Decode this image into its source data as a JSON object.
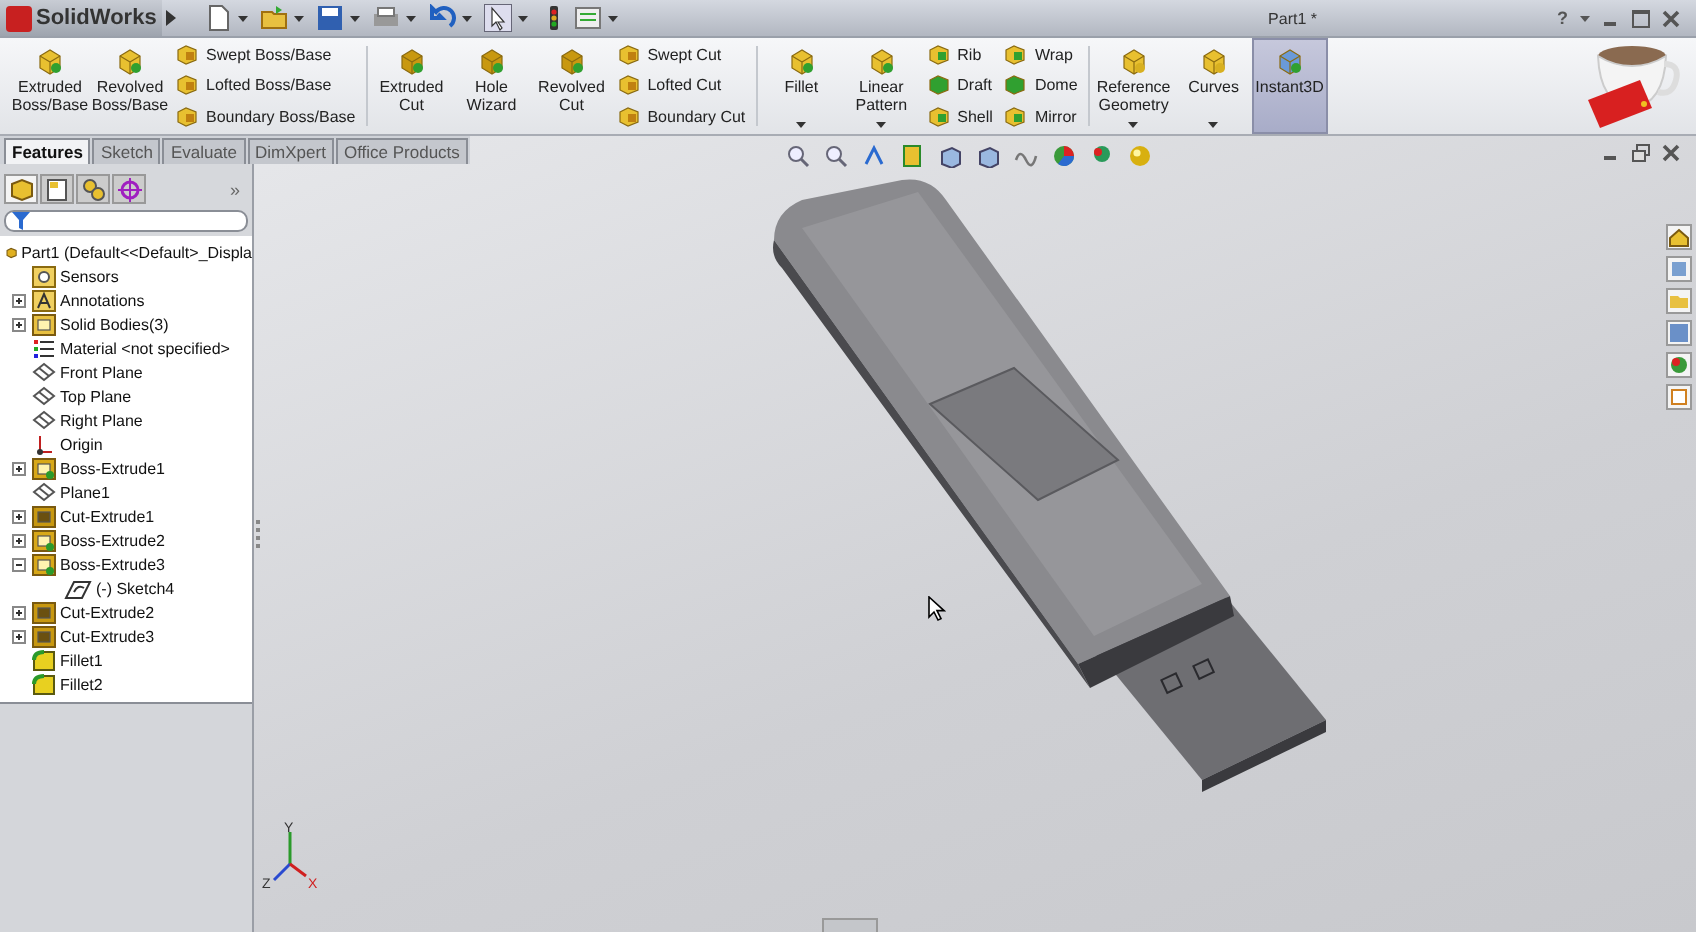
{
  "app": {
    "logo": "SolidWorks",
    "title": "Part1 *",
    "help": "?"
  },
  "ribbon": {
    "groups": [
      {
        "items": [
          {
            "kind": "large",
            "label": "Extruded Boss/Base",
            "dropdown": false,
            "on": false
          },
          {
            "kind": "large",
            "label": "Revolved Boss/Base",
            "dropdown": false,
            "on": false
          },
          {
            "kind": "stack",
            "entries": [
              "Swept Boss/Base",
              "Lofted Boss/Base",
              "Boundary Boss/Base"
            ]
          }
        ]
      },
      {
        "items": [
          {
            "kind": "large",
            "label": "Extruded Cut",
            "dropdown": false,
            "on": false
          },
          {
            "kind": "large",
            "label": "Hole Wizard",
            "dropdown": false,
            "on": false
          },
          {
            "kind": "large",
            "label": "Revolved Cut",
            "dropdown": false,
            "on": false
          },
          {
            "kind": "stack",
            "entries": [
              "Swept Cut",
              "Lofted Cut",
              "Boundary Cut"
            ]
          }
        ]
      },
      {
        "items": [
          {
            "kind": "large",
            "label": "Fillet",
            "dropdown": true,
            "on": false
          },
          {
            "kind": "large",
            "label": "Linear Pattern",
            "dropdown": true,
            "on": false
          },
          {
            "kind": "stack",
            "entries": [
              "Rib",
              "Draft",
              "Shell"
            ]
          },
          {
            "kind": "stack",
            "entries": [
              "Wrap",
              "Dome",
              "Mirror"
            ]
          }
        ]
      },
      {
        "items": [
          {
            "kind": "large",
            "label": "Reference Geometry",
            "dropdown": true,
            "on": false
          },
          {
            "kind": "large",
            "label": "Curves",
            "dropdown": true,
            "on": false
          }
        ]
      },
      {
        "items": [
          {
            "kind": "large",
            "label": "Instant3D",
            "dropdown": false,
            "on": true
          }
        ]
      }
    ]
  },
  "tabs": [
    {
      "label": "Features",
      "selected": true
    },
    {
      "label": "Sketch",
      "selected": false
    },
    {
      "label": "Evaluate",
      "selected": false
    },
    {
      "label": "DimXpert",
      "selected": false
    },
    {
      "label": "Office Products",
      "selected": false
    }
  ],
  "panel": {
    "tabs": [
      {
        "selected": true
      },
      {
        "selected": false
      },
      {
        "selected": false
      },
      {
        "selected": false
      }
    ],
    "more": "»"
  },
  "tree": {
    "root": {
      "label": "Part1  (Default<<Default>_Displa",
      "kind": "part"
    },
    "items": [
      {
        "label": "Sensors",
        "kind": "sensors"
      },
      {
        "label": "Annotations",
        "kind": "annotations",
        "expanded": false
      },
      {
        "label": "Solid Bodies(3)",
        "kind": "bodies",
        "expanded": false
      },
      {
        "label": "Material <not specified>",
        "kind": "material"
      },
      {
        "label": "Front Plane",
        "kind": "plane"
      },
      {
        "label": "Top Plane",
        "kind": "plane"
      },
      {
        "label": "Right Plane",
        "kind": "plane"
      },
      {
        "label": "Origin",
        "kind": "origin"
      },
      {
        "label": "Boss-Extrude1",
        "kind": "boss",
        "expanded": false
      },
      {
        "label": "Plane1",
        "kind": "plane"
      },
      {
        "label": "Cut-Extrude1",
        "kind": "cut",
        "expanded": false
      },
      {
        "label": "Boss-Extrude2",
        "kind": "boss",
        "expanded": false
      },
      {
        "label": "Boss-Extrude3",
        "kind": "boss",
        "expanded": true,
        "children": [
          {
            "label": "(-) Sketch4",
            "kind": "sketch"
          }
        ]
      },
      {
        "label": "Cut-Extrude2",
        "kind": "cut",
        "expanded": false
      },
      {
        "label": "Cut-Extrude3",
        "kind": "cut",
        "expanded": false
      },
      {
        "label": "Fillet1",
        "kind": "fillet"
      },
      {
        "label": "Fillet2",
        "kind": "fillet"
      }
    ]
  },
  "viewport": {
    "triad": [
      "Y",
      "Z",
      "X"
    ]
  }
}
